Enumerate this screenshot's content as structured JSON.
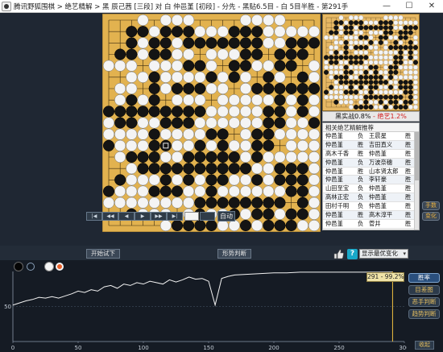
{
  "window": {
    "title": "腾讯野狐围棋 > 绝艺精解 > 黑 辰己茜 [三段] 对 白 仲邑堇 [初段] - 分先 - 黑贴6.5目 - 白 5目半胜 - 第291手",
    "minimize_label": "—",
    "maximize_label": "☐",
    "close_label": "✕"
  },
  "board": {
    "size": 19,
    "colors": {
      "wood": "#e2b24f",
      "line": "#3a2a10",
      "black": "#141414",
      "white": "#f4f4f4"
    },
    "rows": [
      "...O.OOO....OOOO...",
      "..XXOXXXOOOXXXOOOOO",
      "..XOXXOXXXXXXXOOXXX",
      ".XXOXXOO.OOOXX.XXX.",
      "OOO.OOOXXO.XXOOXX.O",
      "..OOXOOOOXOXO.XO.XO",
      ".OO.XOXXXOO.OXXXXXX",
      ".OXOX.OOO.OOOOOXOXO",
      "XXXXXXXXXOOOOOXXOXO",
      "OXXOOXXXOOOOOOXXOOX",
      "OOOOXOOOOXX.OXXOOOO",
      "XOOOXXOOXOXOOXX.OOO",
      ".OXXXOOXXXXXOXOOOOO",
      "..OXXXXXXXXXXOOXXXO",
      ".XOOOXOXOXXOOXOXXXO",
      "XOOOXXXOOXOOOOOOXXO",
      "OOOOOOOOXXXXXXXX.XO",
      "..XOOO.OXOOXOXXOXXO",
      ".....OXXXXOOXOXXXOO"
    ],
    "last_move": {
      "row": 11,
      "col": 5
    }
  },
  "mini_board": {
    "label": "minimap"
  },
  "score": {
    "black": "黑实战0.8%",
    "separator": "-",
    "white": "绝艺1.2%"
  },
  "related_games": {
    "header": "相关绝艺精解推荐",
    "rows": [
      {
        "black": "仲邑堇",
        "result": "负",
        "white": "王晨星",
        "suffix": "胜"
      },
      {
        "black": "仲邑堇",
        "result": "胜",
        "white": "吉田直义",
        "suffix": "胜"
      },
      {
        "black": "高木千香",
        "result": "胜",
        "white": "仲邑堇",
        "suffix": "胜"
      },
      {
        "black": "仲邑堇",
        "result": "负",
        "white": "万波奈穗",
        "suffix": "胜"
      },
      {
        "black": "仲邑堇",
        "result": "胜",
        "white": "山本贤太郎",
        "suffix": "胜"
      },
      {
        "black": "仲邑堇",
        "result": "负",
        "white": "李轩豪",
        "suffix": "胜"
      },
      {
        "black": "山田至宝",
        "result": "负",
        "white": "仲邑堇",
        "suffix": "胜"
      },
      {
        "black": "高林正宏",
        "result": "负",
        "white": "仲邑堇",
        "suffix": "胜"
      },
      {
        "black": "田村千明",
        "result": "负",
        "white": "仲邑堇",
        "suffix": "胜"
      },
      {
        "black": "仲邑堇",
        "result": "胜",
        "white": "高木淳平",
        "suffix": "胜"
      },
      {
        "black": "仲邑堇",
        "result": "负",
        "white": "菅井",
        "suffix": "胜"
      }
    ]
  },
  "side_buttons": {
    "analysis": "手数",
    "variation": "变化"
  },
  "controls": {
    "first": "|◀",
    "back10": "◀◀",
    "back1": "◀",
    "fwd1": "▶",
    "fwd10": "▶▶",
    "last": "▶|",
    "goto": "GO",
    "auto": "自动",
    "trial": "开始试下",
    "situation": "形势判断",
    "option": "显示最优变化"
  },
  "chart_data": {
    "type": "line",
    "title": "",
    "xlabel": "",
    "ylabel": "",
    "xlim": [
      0,
      300
    ],
    "ylim": [
      0,
      100
    ],
    "x_ticks": [
      "0",
      "50",
      "100",
      "150",
      "200",
      "250",
      "300"
    ],
    "y_ticks": [
      "50"
    ],
    "tooltip": "291 - 99.2%",
    "series": [
      {
        "x": [
          0,
          5,
          10,
          15,
          20,
          25,
          30,
          35,
          40,
          45,
          50,
          55,
          60,
          65,
          70,
          75,
          80,
          85,
          90,
          95,
          100,
          105,
          110,
          115,
          120,
          125,
          130,
          135,
          140,
          145,
          150,
          155,
          160,
          165,
          170,
          180,
          190,
          200,
          210,
          220,
          230,
          240,
          250,
          260,
          270,
          280,
          291
        ],
        "y": [
          52,
          55,
          58,
          60,
          63,
          62,
          64,
          62,
          65,
          68,
          72,
          70,
          74,
          72,
          78,
          80,
          76,
          82,
          80,
          84,
          82,
          86,
          84,
          82,
          88,
          85,
          88,
          92,
          89,
          90,
          86,
          52,
          90,
          93,
          95,
          96,
          97,
          98,
          98,
          99,
          99,
          99,
          99,
          99,
          99,
          99,
          99.2
        ]
      }
    ],
    "current_move": 291
  },
  "chart_buttons": {
    "winrate": "胜率",
    "target": "目差图",
    "error": "恶手判断",
    "trend": "趋势判断",
    "close": "收起"
  }
}
